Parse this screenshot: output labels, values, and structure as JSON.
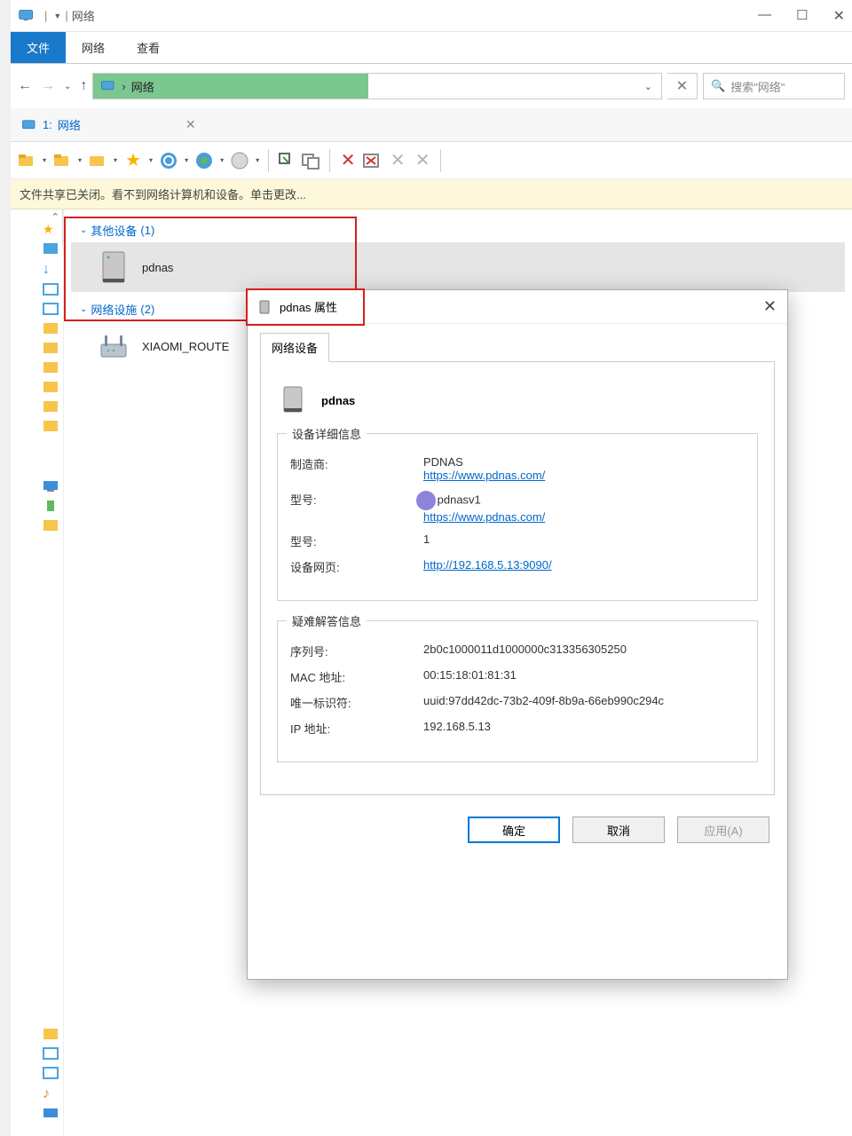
{
  "window": {
    "title": "网络"
  },
  "ribbon": {
    "file": "文件",
    "network": "网络",
    "view": "查看"
  },
  "address": {
    "location": "网络",
    "search_placeholder": "搜索\"网络\""
  },
  "tab": {
    "index": "1:",
    "label": "网络"
  },
  "info_bar": "文件共享已关闭。看不到网络计算机和设备。单击更改...",
  "groups": {
    "other": {
      "label": "其他设备",
      "count": "(1)"
    },
    "infra": {
      "label": "网络设施",
      "count": "(2)"
    }
  },
  "devices": {
    "pdnas": "pdnas",
    "router": "XIAOMI_ROUTE"
  },
  "dialog": {
    "title": "pdnas 属性",
    "tab": "网络设备",
    "name": "pdnas",
    "group1_label": "设备详细信息",
    "group2_label": "疑难解答信息",
    "labels": {
      "manufacturer": "制造商:",
      "model": "型号:",
      "model2": "型号:",
      "devpage": "设备网页:",
      "serial": "序列号:",
      "mac": "MAC 地址:",
      "uniq": "唯一标识符:",
      "ip": "IP 地址:"
    },
    "values": {
      "manufacturer": "PDNAS",
      "manufacturer_url": "https://www.pdnas.com/",
      "model": "pdnasv1",
      "model_url": "https://www.pdnas.com/",
      "model2": "1",
      "devpage_url": "http://192.168.5.13:9090/",
      "serial": "2b0c1000011d1000000c313356305250",
      "mac": "00:15:18:01:81:31",
      "uniq": "uuid:97dd42dc-73b2-409f-8b9a-66eb990c294c",
      "ip": "192.168.5.13"
    },
    "buttons": {
      "ok": "确定",
      "cancel": "取消",
      "apply": "应用(A)"
    }
  }
}
